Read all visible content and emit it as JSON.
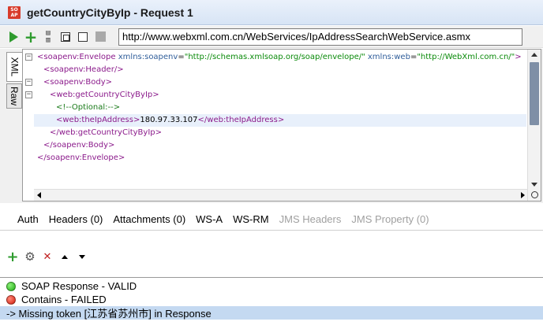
{
  "window": {
    "title": "getCountryCityByIp - Request 1",
    "icon": "soap-icon",
    "icon_text": "SO AP"
  },
  "toolbar": {
    "buttons": [
      "run-request-icon",
      "add-icon",
      "split-view-icon",
      "tabs-layout-icon",
      "single-panel-icon",
      "stop-icon"
    ],
    "endpoint_url": "http://www.webxml.com.cn/WebServices/IpAddressSearchWebService.asmx"
  },
  "editor": {
    "side_tabs": [
      "XML",
      "Raw"
    ],
    "active_tab": "XML",
    "lines": [
      {
        "open": "<",
        "tag": "soapenv:Envelope",
        "attrs": [
          {
            "name": "xmlns:soapenv",
            "value": "\"http://schemas.xmlsoap.org/soap/envelope/\""
          },
          {
            "name": "xmlns:web",
            "value": "\"http://WebXml.com.cn/\""
          }
        ],
        "close": ">"
      },
      {
        "text": "<soapenv:Header/>"
      },
      {
        "text": "<soapenv:Body>"
      },
      {
        "text": "<web:getCountryCityByIp>"
      },
      {
        "text": "<!--Optional:-->"
      },
      {
        "open_tag": "<web:theIpAddress>",
        "value": "180.97.33.107",
        "close_tag": "</web:theIpAddress>"
      },
      {
        "text": "</web:getCountryCityByIp>"
      },
      {
        "text": "</soapenv:Body>"
      },
      {
        "text": "</soapenv:Envelope>"
      }
    ]
  },
  "bottom_tabs": [
    {
      "label": "Auth",
      "enabled": true
    },
    {
      "label": "Headers (0)",
      "enabled": true
    },
    {
      "label": "Attachments (0)",
      "enabled": true
    },
    {
      "label": "WS-A",
      "enabled": true
    },
    {
      "label": "WS-RM",
      "enabled": true
    },
    {
      "label": "JMS Headers",
      "enabled": false
    },
    {
      "label": "JMS Property (0)",
      "enabled": false
    }
  ],
  "assertions": {
    "toolbar": [
      "add-assertion-icon",
      "configure-assertion-icon",
      "remove-assertion-icon",
      "move-up-icon",
      "move-down-icon"
    ],
    "items": [
      {
        "label": "SOAP Response - VALID",
        "status": "green"
      },
      {
        "label": "Contains - FAILED",
        "status": "red"
      },
      {
        "label": "-> Missing token [江苏省苏州市] in Response",
        "status": "detail"
      }
    ]
  },
  "colors": {
    "tag": "#8b1a8b",
    "attribute": "#2f5d9a",
    "value": "#0a8a0a",
    "selection": "#c4d9f1",
    "valid": "#1fae13",
    "failed": "#d21a0a"
  }
}
